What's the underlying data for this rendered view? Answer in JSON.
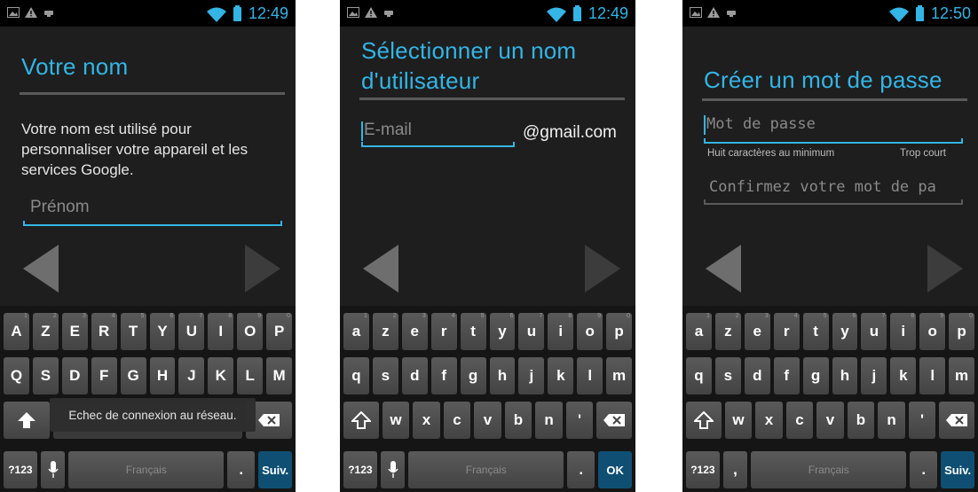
{
  "status_times": [
    "12:49",
    "12:49",
    "12:50"
  ],
  "screens": [
    {
      "title_lines": [
        "Votre nom"
      ],
      "description": "Votre nom est utilisé pour personnaliser votre appareil et les services Google.",
      "first_name_placeholder": "Prénom",
      "toast": "Echec de connexion au réseau.",
      "keys_row1": [
        "A",
        "Z",
        "E",
        "R",
        "T",
        "Y",
        "U",
        "I",
        "O",
        "P"
      ],
      "keys_row2": [
        "Q",
        "S",
        "D",
        "F",
        "G",
        "H",
        "J",
        "K",
        "L",
        "M"
      ],
      "mode_key": "?123",
      "space_label": "Français",
      "action_key": "Suiv."
    },
    {
      "title_lines": [
        "Sélectionner un nom",
        "d'utilisateur"
      ],
      "email_placeholder": "E-mail",
      "domain_suffix": "@gmail.com",
      "keys_row1": [
        "a",
        "z",
        "e",
        "r",
        "t",
        "y",
        "u",
        "i",
        "o",
        "p"
      ],
      "keys_row2": [
        "q",
        "s",
        "d",
        "f",
        "g",
        "h",
        "j",
        "k",
        "l",
        "m"
      ],
      "keys_row3": [
        "w",
        "x",
        "c",
        "v",
        "b",
        "n",
        "'"
      ],
      "mode_key": "?123",
      "space_label": "Français",
      "action_key": "OK"
    },
    {
      "title_lines": [
        "Créer un mot de passe"
      ],
      "password_placeholder": "Mot de passe",
      "password_hint": "Huit caractères au minimum",
      "password_strength": "Trop court",
      "confirm_placeholder": "Confirmez votre mot de pa",
      "keys_row1": [
        "a",
        "z",
        "e",
        "r",
        "t",
        "y",
        "u",
        "i",
        "o",
        "p"
      ],
      "keys_row2": [
        "q",
        "s",
        "d",
        "f",
        "g",
        "h",
        "j",
        "k",
        "l",
        "m"
      ],
      "keys_row3": [
        "w",
        "x",
        "c",
        "v",
        "b",
        "n",
        "'"
      ],
      "mode_key": "?123",
      "comma_key": ",",
      "space_label": "Français",
      "action_key": "Suiv."
    }
  ],
  "key_numbers": [
    "1",
    "2",
    "3",
    "4",
    "5",
    "6",
    "7",
    "8",
    "9",
    "0"
  ],
  "period_key": ".",
  "colors": {
    "accent": "#33b5e5",
    "background": "#1e1e1e",
    "action_blue": "#0f4f73"
  }
}
